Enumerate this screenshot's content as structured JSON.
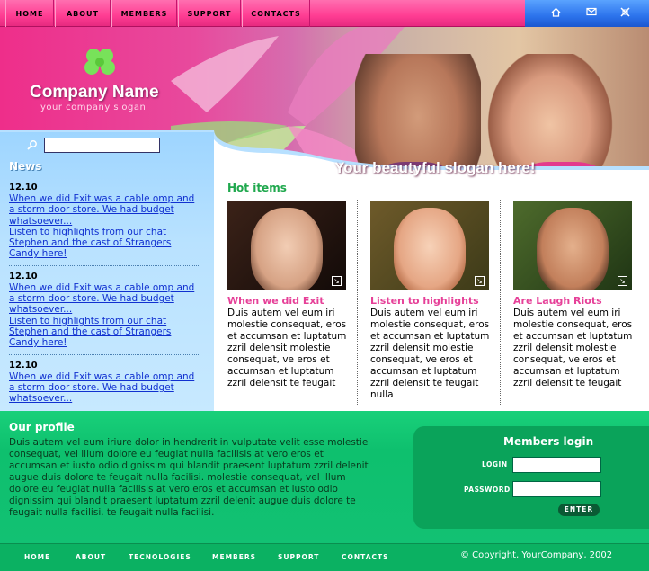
{
  "top_nav": [
    "HOME",
    "ABOUT",
    "MEMBERS",
    "SUPPORT",
    "CONTACTS"
  ],
  "top_icons": [
    "home-icon",
    "mail-icon",
    "sitemap-icon"
  ],
  "brand": {
    "company_name": "Company Name",
    "company_slogan": "your company slogan",
    "main_slogan": "Your beautyful slogan here!"
  },
  "search": {
    "value": ""
  },
  "news": {
    "title": "News",
    "blocks": [
      {
        "date": "12.10",
        "link1": "When we did Exit was a cable omp and a storm door store. We had budget whatsoever...",
        "link2": "Listen to highlights from our chat Stephen and the cast of Strangers Candy here!"
      },
      {
        "date": "12.10",
        "link1": "When we did Exit was a cable omp and a storm door store. We had budget whatsoever...",
        "link2": "Listen to highlights from our chat Stephen and the cast of Strangers Candy here!"
      },
      {
        "date": "12.10",
        "link1": "When we did Exit was a cable omp and a storm door store. We had budget whatsoever..."
      }
    ]
  },
  "hot_items": {
    "title": "Hot items",
    "items": [
      {
        "title": "When we did Exit",
        "text": "Duis autem vel eum iri molestie consequat, eros et accumsan et luptatum zzril delensit molestie consequat, ve eros et accumsan et luptatum zzril delensit te feugait"
      },
      {
        "title": "Listen to highlights",
        "text": "Duis autem vel eum iri molestie consequat, eros et accumsan et luptatum zzril delensit molestie consequat, ve eros et accumsan et luptatum zzril delensit te feugait nulla"
      },
      {
        "title": "Are Laugh Riots",
        "text": "Duis autem vel eum iri molestie consequat, eros et accumsan et luptatum zzril delensit molestie consequat, ve eros et accumsan et luptatum zzril delensit te feugait"
      }
    ]
  },
  "profile": {
    "title": "Our profile",
    "text": "Duis autem vel eum iriure dolor in hendrerit in vulputate velit esse molestie consequat, vel illum dolore eu feugiat nulla facilisis at vero eros et accumsan et iusto odio dignissim qui blandit praesent luptatum zzril delenit augue duis dolore te feugait nulla facilisi. molestie consequat, vel illum dolore eu feugiat nulla facilisis at vero eros et accumsan et iusto odio dignissim qui blandit praesent luptatum zzril delenit augue duis dolore te feugait nulla facilisi. te feugait nulla facilisi."
  },
  "login": {
    "title": "Members login",
    "login_label": "LOGIN",
    "password_label": "PASSWORD",
    "login_value": "",
    "password_value": "",
    "enter_label": "ENTER"
  },
  "footer": {
    "links": [
      "HOME",
      "ABOUT",
      "TECNOLOGIES",
      "MEMBERS",
      "SUPPORT",
      "CONTACTS"
    ],
    "copyright": "© Copyright, YourCompany, 2002"
  },
  "colors": {
    "pink": "#ff3d93",
    "blue": "#2c73ec",
    "green": "#12c173",
    "link": "#1030d0",
    "item_title": "#e64098"
  }
}
